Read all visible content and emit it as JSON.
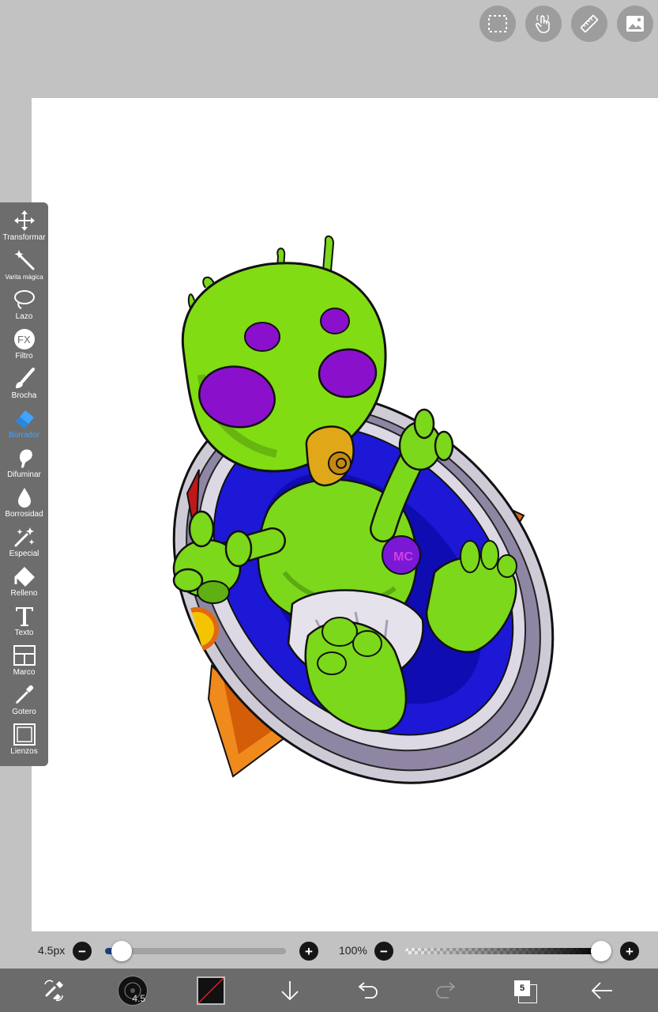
{
  "top_bar": {
    "buttons": [
      {
        "icon": "selection-icon"
      },
      {
        "icon": "hand-gesture-icon"
      },
      {
        "icon": "ruler-icon"
      },
      {
        "icon": "image-icon"
      }
    ]
  },
  "toolbar": {
    "tools": [
      {
        "label": "Transformar",
        "icon": "move-icon"
      },
      {
        "label": "Varita mágica",
        "icon": "magic-wand-icon"
      },
      {
        "label": "Lazo",
        "icon": "lasso-icon"
      },
      {
        "label": "Filtro",
        "icon": "fx-icon"
      },
      {
        "label": "Brocha",
        "icon": "brush-icon"
      },
      {
        "label": "Borrador",
        "icon": "eraser-icon",
        "active": true
      },
      {
        "label": "Difuminar",
        "icon": "smudge-icon"
      },
      {
        "label": "Borrosidad",
        "icon": "blur-drop-icon"
      },
      {
        "label": "Especial",
        "icon": "sparkle-icon"
      },
      {
        "label": "Relleno",
        "icon": "fill-bucket-icon"
      },
      {
        "label": "Texto",
        "icon": "text-icon"
      },
      {
        "label": "Marco",
        "icon": "frame-icon"
      },
      {
        "label": "Gotero",
        "icon": "eyedropper-icon"
      },
      {
        "label": "Lienzos",
        "icon": "canvas-icon"
      }
    ]
  },
  "sliders": {
    "size_label": "4.5px",
    "size_fraction": 0.09,
    "opacity_label": "100%",
    "opacity_fraction": 1.0,
    "minus": "−",
    "plus": "+"
  },
  "bottom_bar": {
    "brush_size": "4.5",
    "layer_count": "5",
    "items": [
      "swap-tool-icon",
      "brush-size-preview",
      "color-swatch",
      "download-icon",
      "undo-icon",
      "redo-icon",
      "layers-icon",
      "back-arrow-icon"
    ]
  },
  "colors": {
    "accent_blue": "#3fa3ff",
    "toolbar_bg": "#6d6d6d",
    "bottom_bar_bg": "#6b6b6b",
    "workspace_bg": "#c2c2c2"
  }
}
